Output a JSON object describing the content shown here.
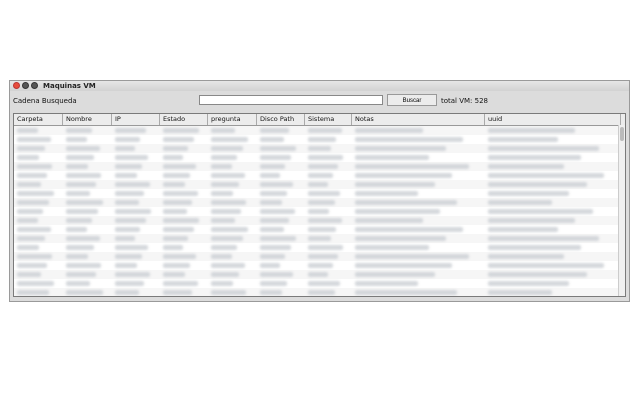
{
  "window": {
    "title": "Maquinas VM"
  },
  "search": {
    "label": "Cadena Busqueda",
    "value": "",
    "placeholder": "",
    "button_label": "Buscar",
    "total_label": "total VM: 528"
  },
  "table": {
    "columns": [
      "Carpeta",
      "Nombre",
      "IP",
      "Estado",
      "pregunta",
      "Disco Path",
      "Sistema",
      "Notas",
      "uuid"
    ],
    "row_count": 19
  },
  "colors": {
    "close": "#e74c3c",
    "window_bg": "#dcdcdc"
  }
}
